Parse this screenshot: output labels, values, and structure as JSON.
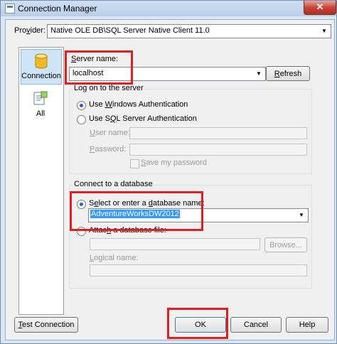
{
  "window": {
    "title": "Connection Manager",
    "close_symbol": "✕"
  },
  "provider": {
    "label": "Provider:",
    "value": "Native OLE DB\\SQL Server Native Client 11.0"
  },
  "sidebar": {
    "items": [
      {
        "label": "Connection"
      },
      {
        "label": "All"
      }
    ]
  },
  "server": {
    "label": "Server name:",
    "value": "localhost",
    "refresh_label": "Refresh"
  },
  "logon": {
    "group_title": "Log on to the server",
    "windows_auth": "Use Windows Authentication",
    "sql_auth": "Use SQL Server Authentication",
    "user_label": "User name:",
    "password_label": "Password:",
    "save_password": "Save my password"
  },
  "database": {
    "group_title": "Connect to a database",
    "select_label": "Select or enter a database name:",
    "selected_db": "AdventureWorksDW2012",
    "attach_label": "Attach a database file:",
    "browse_label": "Browse...",
    "logical_label": "Logical name:"
  },
  "footer": {
    "test_label": "Test Connection",
    "ok_label": "OK",
    "cancel_label": "Cancel",
    "help_label": "Help"
  },
  "colors": {
    "highlight": "#e02020",
    "selection": "#3399ff"
  },
  "icons": {
    "connection": "database-cylinder-icon",
    "all": "property-sheet-icon",
    "close": "close-icon",
    "dropdown": "chevron-down-icon"
  }
}
